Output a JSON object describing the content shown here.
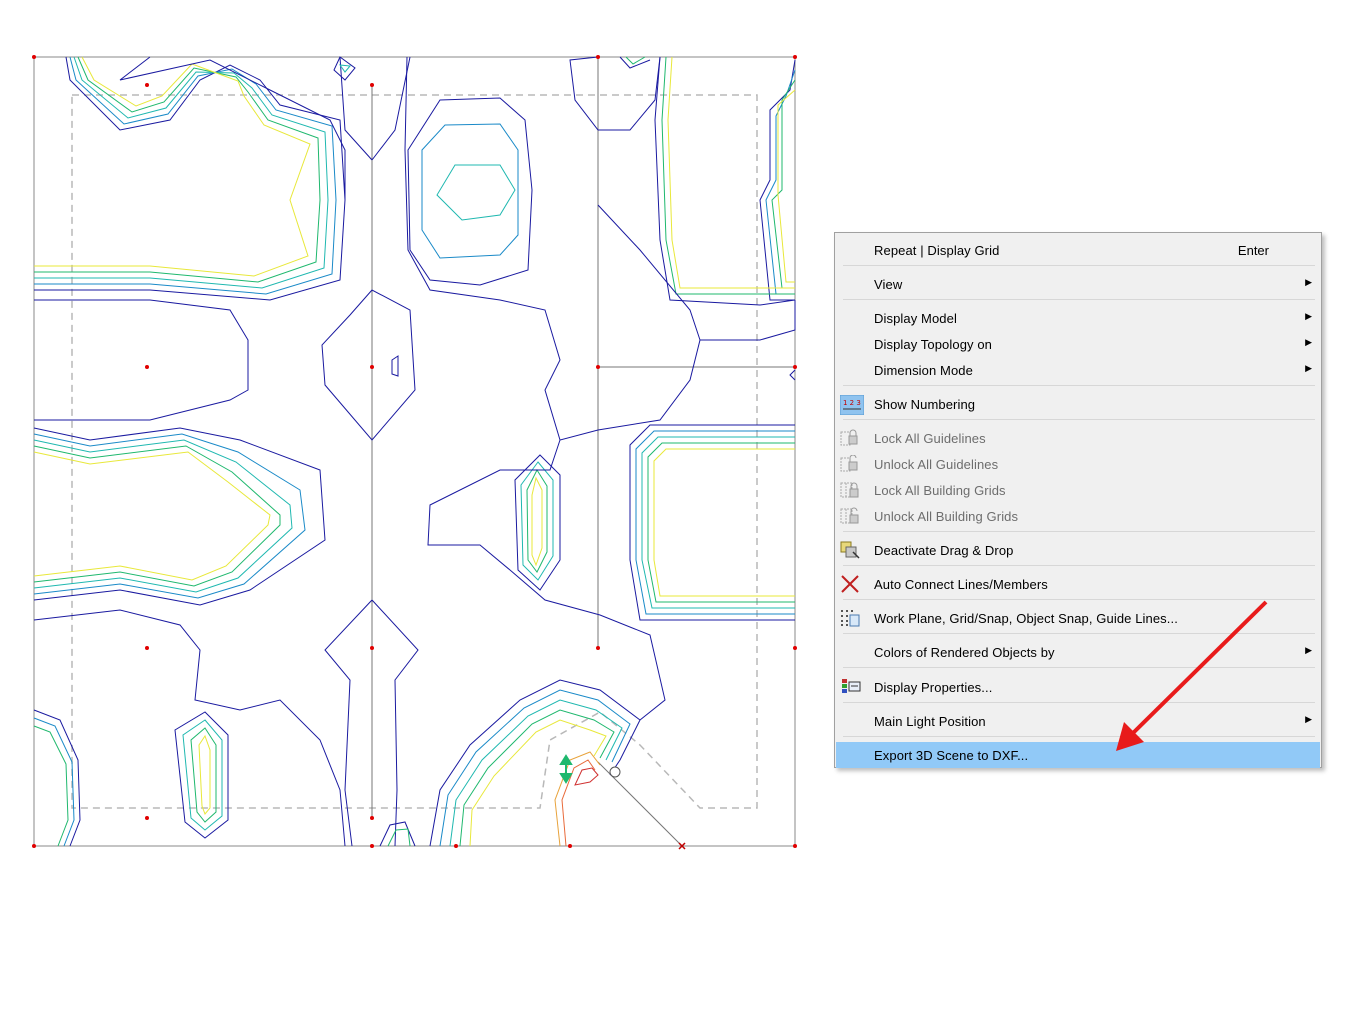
{
  "menu": {
    "items": [
      {
        "label": "Repeat | Display Grid",
        "shortcut": "Enter"
      },
      {
        "label": "View"
      },
      {
        "label": "Display Model"
      },
      {
        "label": "Display Topology on"
      },
      {
        "label": "Dimension Mode"
      },
      {
        "label": "Show Numbering"
      },
      {
        "label": "Lock All Guidelines",
        "disabled": true
      },
      {
        "label": "Unlock All Guidelines",
        "disabled": true
      },
      {
        "label": "Lock All Building Grids",
        "disabled": true
      },
      {
        "label": "Unlock All Building Grids",
        "disabled": true
      },
      {
        "label": "Deactivate Drag & Drop"
      },
      {
        "label": "Auto Connect Lines/Members"
      },
      {
        "label": "Work Plane, Grid/Snap, Object Snap, Guide Lines..."
      },
      {
        "label": "Colors of Rendered Objects by"
      },
      {
        "label": "Display Properties..."
      },
      {
        "label": "Main Light Position"
      },
      {
        "label": "Export 3D Scene to DXF...",
        "highlighted": true
      }
    ]
  },
  "icons": {
    "numbering": "numbering-icon",
    "lock": "lock-icon",
    "drag": "drag-drop-icon",
    "auto_connect": "auto-connect-icon",
    "work_plane": "work-plane-grid-icon",
    "display_properties": "display-properties-icon",
    "submenu": "submenu-arrow-icon"
  },
  "colors": {
    "highlight": "#91c9f7",
    "annotation_arrow": "#e81b1b",
    "contour_blue": "#1a1aa0",
    "contour_green": "#1fb86e",
    "contour_yellow": "#e8e83a",
    "node_red": "#e00000"
  }
}
